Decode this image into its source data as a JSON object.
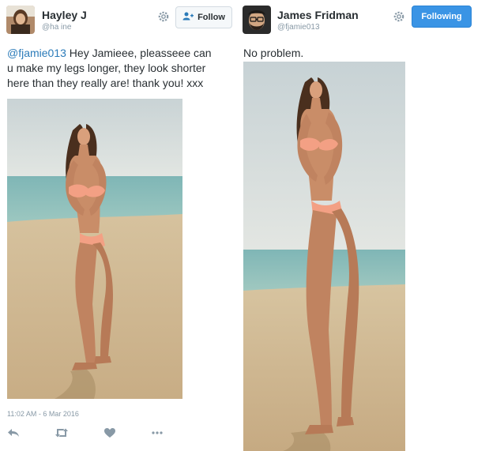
{
  "left_tweet": {
    "user_name": "Hayley J",
    "user_handle": "@ha          ine",
    "follow_label": "Follow",
    "mention": "@fjamie013",
    "text_line1_rest": " Hey Jamieee, pleasseee can",
    "text_line2": "u make my legs longer, they look shorter",
    "text_line3": "here than they really are! thank you! xxx",
    "timestamp": "11:02 AM - 6 Mar 2016",
    "icons": [
      "reply-icon",
      "retweet-icon",
      "like-icon",
      "more-icon"
    ]
  },
  "right_tweet": {
    "user_name": "James Fridman",
    "user_handle": "@fjamie013",
    "following_label": "Following",
    "text": "No problem."
  },
  "colors": {
    "link": "#2b7bb9",
    "following_button": "#3a94e5",
    "muted": "#8899a6"
  }
}
